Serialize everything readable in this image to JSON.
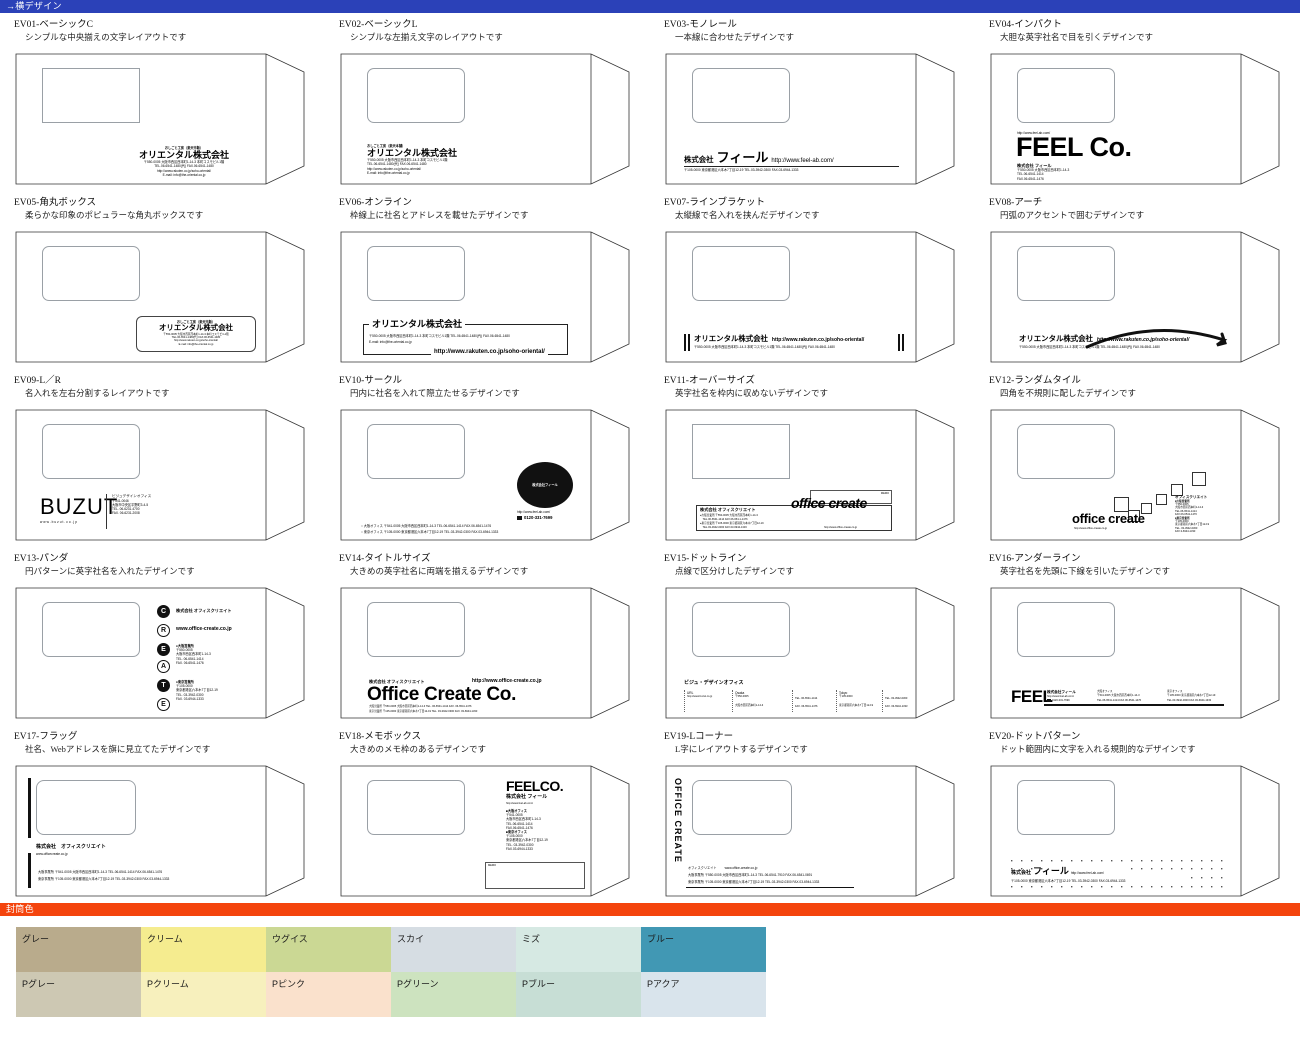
{
  "sections": {
    "designs_header": "→横デザイン",
    "colors_header": "封筒色"
  },
  "colors": {
    "blue_bar": "#2b41b8",
    "orange_bar": "#f4440d"
  },
  "designs": [
    {
      "code": "EV01-ベーシックC",
      "desc": "シンプルな中央揃えの文字レイアウトです",
      "company_small": "おしごと工房（楽天市販）",
      "company": "オリエンタル株式会社",
      "line1": "〒550-0005  大阪市西区西本町1-14-3 本町コスモビル1階",
      "line2": "TEL.06-6541-1480(代)  FAX.06-6541-1480",
      "line3": "http://www.rakuten.co.jp/soho-oriental/",
      "line4": "E-mail: info@the-oriental.co.jp"
    },
    {
      "code": "EV02-ベーシックL",
      "desc": "シンプルな左揃え文字のレイアウトです",
      "company_small": "おしごと工房（楽天本舗）",
      "company": "オリエンタル株式会社",
      "line1": "〒550-0005  大阪市西区西本町1-14-3 本町コスモビル1階",
      "line2": "TEL.06-6541-1480(代)  FAX.06-6541-1480",
      "line3": "http://www.rakuten.co.jp/soho-oriental/",
      "line4": "E-mail: info@the-oriental.co.jp"
    },
    {
      "code": "EV03-モノレール",
      "desc": "一本線に合わせたデザインです",
      "company_prefix": "株式会社",
      "company_name": "フィール",
      "url": "http://www.feel-ab.com/",
      "line1": "〒105-0000 東京都港区六本木7丁目12-19  TEL.03-3942-0300  FAX.03-6944-1333"
    },
    {
      "code": "EV04-インパクト",
      "desc": "大胆な英字社名で目を引くデザインです",
      "url": "http://www.feel-ab.com/",
      "logo": "FEEL Co.",
      "company": "株式会社 フィール",
      "line1": "〒550-0005 大阪市西区西本町1-14-3",
      "line2": "TEL.06-6541-1414",
      "line3": "FAX.06-6541-1476"
    },
    {
      "code": "EV05-角丸ボックス",
      "desc": "柔らかな印象のポピュラーな角丸ボックスです",
      "company_small": "おしごと工房（楽天市販）",
      "company": "オリエンタル株式会社",
      "line1": "〒550-0005  大阪市西区西本町1-14-3 本町コスモビル1階",
      "line2": "TEL.06-6541-1480(代)  FAX.06-6541-1480",
      "line3": "http://www.rakuten.co.jp/soho-oriental/",
      "line4": "E-mail: info@the-oriental.co.jp"
    },
    {
      "code": "EV06-オンライン",
      "desc": "枠線上に社名とアドレスを載せたデザインです",
      "company": "オリエンタル株式会社",
      "line1": "〒550-0005  大阪市西区西本町1-14-3 本町コスモビル1階   TEL.06-6541-1480(代)  FAX.06-6541-1480",
      "line2": "E-mail: info@the-oriental.co.jp",
      "url": "http://www.rakuten.co.jp/soho-oriental/"
    },
    {
      "code": "EV07-ラインブラケット",
      "desc": "太縦線で名入れを挟んだデザインです",
      "company": "オリエンタル株式会社",
      "url": "http://www.rakuten.co.jp/soho-oriental/",
      "line1": "〒550-0005  大阪市西区西本町1-14-3 本町コスモビル1階   TEL.06-6541-1480(代)  FAX.06-6541-1480"
    },
    {
      "code": "EV08-アーチ",
      "desc": "円弧のアクセントで囲むデザインです",
      "company": "オリエンタル株式会社",
      "url": "http://www.rakuten.co.jp/soho-oriental/",
      "line1": "〒550-0005  大阪市西区西本町1-14-3 本町コスモビル1階   TEL.06-6541-1480(代)  FAX.06-6541-1480"
    },
    {
      "code": "EV09-L／R",
      "desc": "名入れを左右分割するレイアウトです",
      "logo": "BUZUT",
      "sublogo": "www.buzut.co.jp",
      "r1": "ビジュデザインオフィス",
      "r2": "〒541-0046",
      "r3": "大阪市中央区平野町3-4-5",
      "r4": "TEL. 06-6231-4700",
      "r5": "FAX. 06-6231-2008"
    },
    {
      "code": "EV10-サークル",
      "desc": "円内に社名を入れて際立たせるデザインです",
      "circle_text": "株式会社フィール",
      "url": "http://www.feel-ab.com/",
      "freedial": "0120-331-7699",
      "line1": "○ 大阪オフィス 〒541-0005 大阪市西区西本町1-14-3    TEL.06-6541-1414  FAX.06-6541-1476",
      "line2": "○ 東京オフィス 〒105-0000 東京都港区六本木7丁目12-19  TEL.03-3942-0300  FAX.03-6944-1333"
    },
    {
      "code": "EV11-オーバーサイズ",
      "desc": "英字社名を枠内に収めないデザインです",
      "company": "株式会社 オフィスクリエイト",
      "logo": "office create",
      "url": "http://www.office-create.co.jp",
      "line1": "●大阪営業所  〒550-0005  大阪市西区西本町1-14-3",
      "line2": "　TEL.06-6541-1414   FAX.06-654-1-1476",
      "line3": "●東京営業所  〒105-0000  東京都港区六本木7丁目12-19",
      "line4": "　TEL.03-3942-0300   FAX.03-6944-1333",
      "memo": "MEMO"
    },
    {
      "code": "EV12-ランダムタイル",
      "desc": "四角を不規則に配したデザインです",
      "logo": "office create",
      "url": "http://www.office-create.co.jp",
      "company": "オフィスクリエイト",
      "r1": "■大阪営業所",
      "r2": "〒550-0005",
      "r3": "大阪市西区西本町1-14-3",
      "r4": "TEL.06-6541-1414",
      "r5": "FAX.06-6541-1476",
      "r6": "■東京営業所",
      "r7": "〒105-0000",
      "r8": "東京都港区六本木7丁目12-19",
      "r9": "TEL. 03-3942-0300",
      "r10": "FAX.3-6944-1333"
    },
    {
      "code": "EV13-パンダ",
      "desc": "円パターンに英字社名を入れたデザインです",
      "circles": [
        "C",
        "R",
        "E",
        "A",
        "T",
        "E"
      ],
      "t1": "株式会社 オフィスクリエイト",
      "t2": "www.office-create.co.jp",
      "b1": "●大阪営業所",
      "b2": "〒550-0005",
      "b3": "大阪市西区西本町1-14-3",
      "b4": "TEL. 06-6541-1414",
      "b5": "FAX. 06-6541-1476",
      "c1": "●東京営業所",
      "c2": "〒105-0000",
      "c3": "東京都港区六本木7丁目12-19",
      "c4": "TEL. 03-3942-0300",
      "c5": "FAX. 03-6944-1333"
    },
    {
      "code": "EV14-タイトルサイズ",
      "desc": "大きめの英字社名に両端を揃えるデザインです",
      "company": "株式会社 オフィスクリエイト",
      "url": "http://www.office-create.co.jp",
      "logo": "Office Create Co.",
      "line1": "大阪営業所  〒550-0005  大阪市西区西本町1-14-3  TEL. 06-6541-1414    FAX. 06-6541-1476",
      "line2": "東京営業所  〒105-0000  東京都港区六本木7丁目12-19   TEL. 03-3942-0300   FAX. 03-6944-1333"
    },
    {
      "code": "EV15-ドットライン",
      "desc": "点線で区分けしたデザインです",
      "title": "ビジュ・デザインオフィス",
      "col1_h": "URL",
      "col1_a": "http://www.buzut.co.jp",
      "col2_h": "Osaka",
      "col2_a": "〒550-0005",
      "col2_b": "大阪市西区西本町1-14-3",
      "col3_a": "TEL. 06-6541-1414",
      "col3_b": "FAX. 06-6541-1476",
      "col4_h": "Tokyo",
      "col4_a": "〒105-0000",
      "col4_b": "東京都港区六本木7丁目12-19",
      "col5_a": "TEL. 03-3942-0300",
      "col5_b": "FAX. 03-6944-1333"
    },
    {
      "code": "EV16-アンダーライン",
      "desc": "英字社名を先頭に下線を引いたデザインです",
      "logo": "FEEL",
      "company": "株式会社フィール",
      "url": "http://www.feel-ab.com/",
      "freedial": "0120-331-7699",
      "o_h": "大阪オフィス",
      "o_1": "〒541-0005 大阪市西区西本町1-14-3",
      "o_2": "TEL.06-6541-1414  FAX.06-6541-1476",
      "t_h": "東京オフィス",
      "t_1": "〒105-0000 東京都港区六本木7丁目12-19",
      "t_2": "TEL.03-3942-0300  FAX.03-6944-1333"
    },
    {
      "code": "EV17-フラッグ",
      "desc": "社名、Webアドレスを旗に見立てたデザインです",
      "company": "株式会社　オフィスクリエイト",
      "url": "www.officecreate.co.jp",
      "line1": "大阪事業所  〒541-0005 大阪市西区西本町1-14-3    TEL.06-6541-1414  FAX.06-6541-1476",
      "line2": "東京事業所  〒105-0000 東京都港区六本木7丁目12-19  TEL.03-3942-0300  FAX.03-6944-1333"
    },
    {
      "code": "EV18-メモボックス",
      "desc": "大きめのメモ枠のあるデザインです",
      "logo": "FEELCO.",
      "company": "株式会社 フィール",
      "url": "http://www.feel-ab.com/",
      "r1": "■大阪オフィス",
      "r2": "〒541-0005",
      "r3": "大阪市西区西本町1-14-3",
      "r4": "TEL.06-6541-1414",
      "r5": "FAX.06-6541-1476",
      "r6": "■東京オフィス",
      "r7": "〒105-0000",
      "r8": "東京都港区六本木7丁目12-19",
      "r9": "TEL. 03-3942-0300",
      "r10": "FAX.03-6944-1333",
      "memo": "MEMO"
    },
    {
      "code": "EV19-Lコーナー",
      "desc": "L字にレイアウトするデザインです",
      "vertical": "OFFICE CREATE",
      "company": "オフィスクリエイト",
      "url": "www.office-create.co.jp",
      "line1": "大阪事業所  〒550-0005  大阪市西区西本町1-14-3  TEL.06-6541-7910  FAX.06-6541-0691",
      "line2": "東京事業所  〒105-0000  東京都港区六本木7丁目12-19  TEL.03-3942-0300  FAX.03-6944-1333"
    },
    {
      "code": "EV20-ドットパターン",
      "desc": "ドット範囲内に文字を入れる規則的なデザインです",
      "company_prefix": "株式会社",
      "company_name": "フィール",
      "url": "http://www.feel-ab.com/",
      "line1": "〒105-0000 東京都港区六本木7丁目12-19   TEL.03-3942-0300   FAX.03-6944-1333"
    }
  ],
  "swatches": [
    {
      "label": "グレー",
      "hex": "#b9ab8c"
    },
    {
      "label": "クリーム",
      "hex": "#f5ec8f"
    },
    {
      "label": "ウグイス",
      "hex": "#cbd894"
    },
    {
      "label": "スカイ",
      "hex": "#d6dde3"
    },
    {
      "label": "ミズ",
      "hex": "#d6e9e3"
    },
    {
      "label": "ブルー",
      "hex": "#4198b4"
    },
    {
      "label": "Pグレー",
      "hex": "#cdc8b3"
    },
    {
      "label": "Pクリーム",
      "hex": "#f7f0bd"
    },
    {
      "label": "Pピンク",
      "hex": "#fae1cc"
    },
    {
      "label": "Pグリーン",
      "hex": "#cde3bf"
    },
    {
      "label": "Pブルー",
      "hex": "#c7ded5"
    },
    {
      "label": "Pアクア",
      "hex": "#d9e4ec"
    }
  ]
}
